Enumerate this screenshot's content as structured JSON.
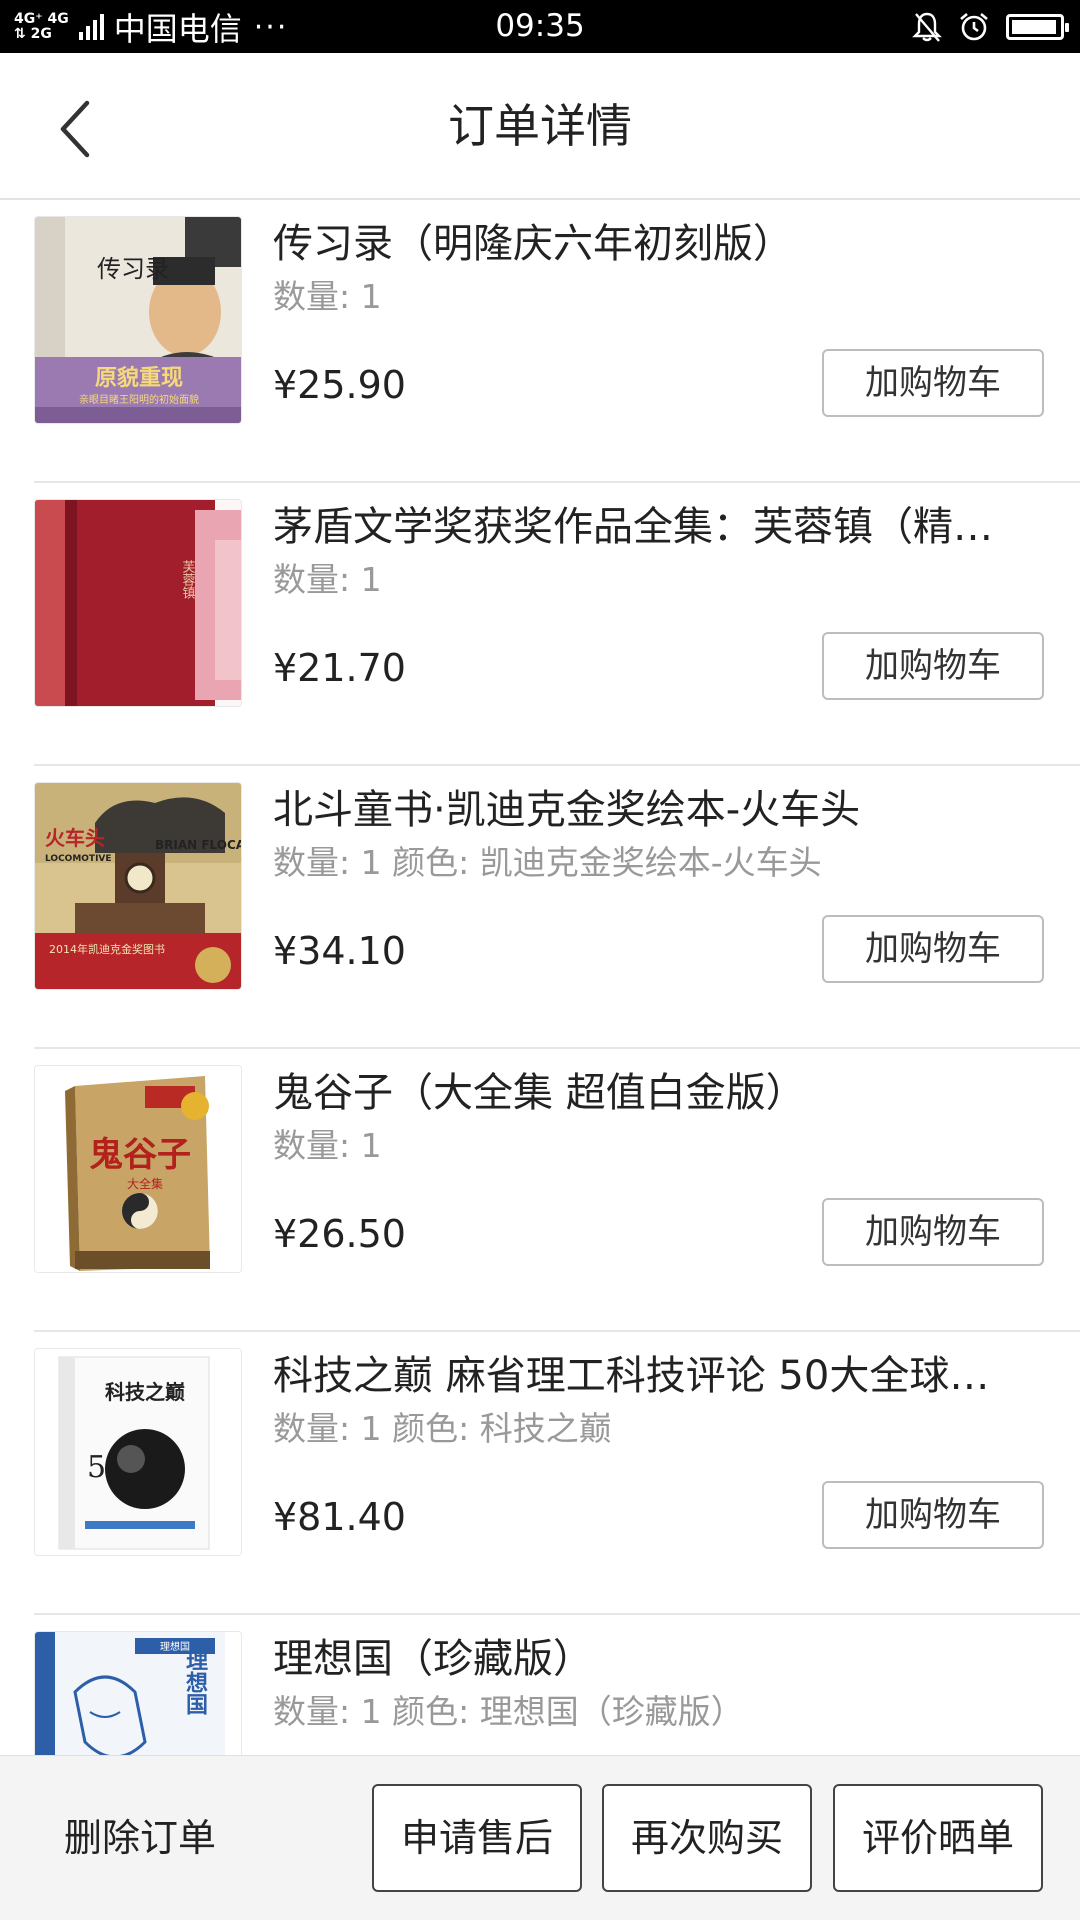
{
  "status_bar": {
    "network_line1": "4G⁺ 4G",
    "network_line2": "⇅ 2G",
    "carrier": "中国电信",
    "carrier_more": "···",
    "time": "09:35",
    "battery_level": 0.95
  },
  "header": {
    "title": "订单详情"
  },
  "items": [
    {
      "title": "传习录（明隆庆六年初刻版）",
      "meta": "数量: 1",
      "price": "¥25.90",
      "button": "加购物车"
    },
    {
      "title": "茅盾文学奖获奖作品全集：芙蓉镇（精…",
      "meta": "数量: 1",
      "price": "¥21.70",
      "button": "加购物车"
    },
    {
      "title": "北斗童书·凯迪克金奖绘本-火车头",
      "meta": "数量: 1 颜色: 凯迪克金奖绘本-火车头",
      "price": "¥34.10",
      "button": "加购物车"
    },
    {
      "title": "鬼谷子（大全集 超值白金版）",
      "meta": "数量: 1",
      "price": "¥26.50",
      "button": "加购物车"
    },
    {
      "title": "科技之巅 麻省理工科技评论 50大全球…",
      "meta": "数量: 1 颜色: 科技之巅",
      "price": "¥81.40",
      "button": "加购物车"
    },
    {
      "title": "理想国（珍藏版）",
      "meta": "数量: 1 颜色: 理想国（珍藏版）",
      "price": "",
      "button": ""
    }
  ],
  "covers": {
    "c1": {
      "title": "传习录",
      "banner": "原貌重现",
      "sub": "亲眼目睹王阳明的初始面貌"
    },
    "c2": {
      "title": "芙蓉镇"
    },
    "c3": {
      "title": "火车头",
      "title_en": "LOCOMOTIVE",
      "author": "BRIAN FLOCA",
      "banner": "2014年凯迪克金奖图书"
    },
    "c4": {
      "title": "鬼谷子",
      "sub": "大全集"
    },
    "c5": {
      "title": "科技之巅"
    },
    "c6": {
      "title": "理想国",
      "top": "理想国"
    }
  },
  "bottom_bar": {
    "delete_label": "删除订单",
    "after_sales_label": "申请售后",
    "buy_again_label": "再次购买",
    "review_label": "评价晒单"
  },
  "colors": {
    "status_bar_bg": "#000000",
    "header_bg": "#ffffff",
    "bottom_bar_bg": "#f4f4f4",
    "meta_text": "#999999",
    "divider": "#e6e6e6"
  }
}
